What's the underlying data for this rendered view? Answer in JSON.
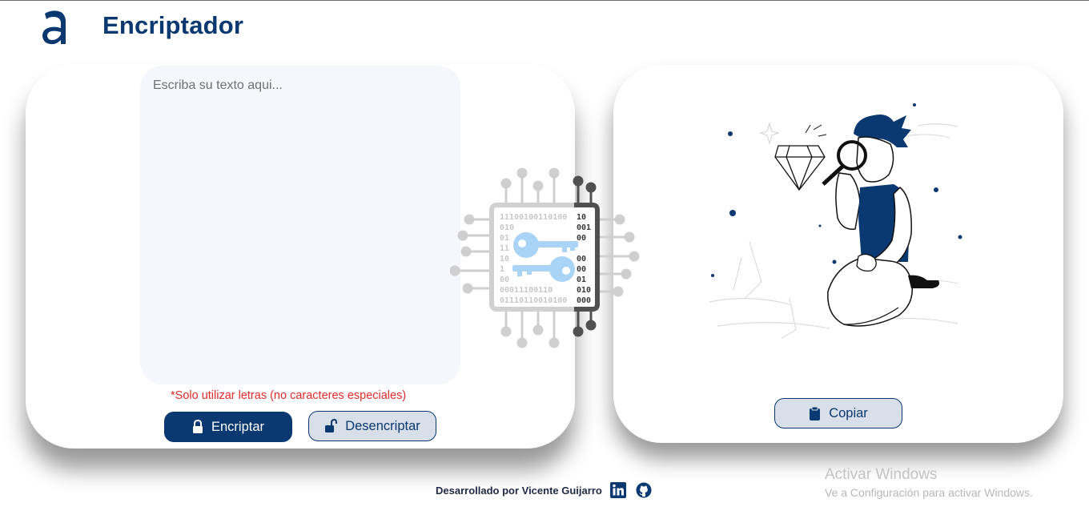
{
  "header": {
    "title": "Encriptador",
    "logo_icon": "alura-a-logo-icon"
  },
  "input": {
    "placeholder": "Escriba su texto aqui...",
    "value": ""
  },
  "warning": "*Solo utilizar letras (no caracteres especiales)",
  "actions": {
    "encrypt_label": "Encriptar",
    "encrypt_icon": "lock-icon",
    "decrypt_label": "Desencriptar",
    "decrypt_icon": "unlock-icon",
    "copy_label": "Copiar",
    "copy_icon": "clipboard-icon"
  },
  "decoration": {
    "chip_text_rows": [
      "11100100110100",
      "010",
      "01",
      "11",
      "10",
      "1",
      "00",
      "00011100110",
      "01110110010100"
    ],
    "chip_right_digits": [
      "10",
      "001",
      "00",
      "00",
      "00",
      "01",
      "010",
      "000"
    ]
  },
  "footer": {
    "text": "Desarrollado por Vicente Guijarro",
    "linkedin_icon": "linkedin-icon",
    "github_icon": "github-icon"
  },
  "watermark": {
    "line1": "Activar Windows",
    "line2": "Ve a Configuración para activar Windows."
  },
  "colors": {
    "brand": "#0a3871",
    "warning": "#e02a2a",
    "input_bg": "#f5f7fc",
    "secondary_button_bg": "#d8dfe8"
  }
}
